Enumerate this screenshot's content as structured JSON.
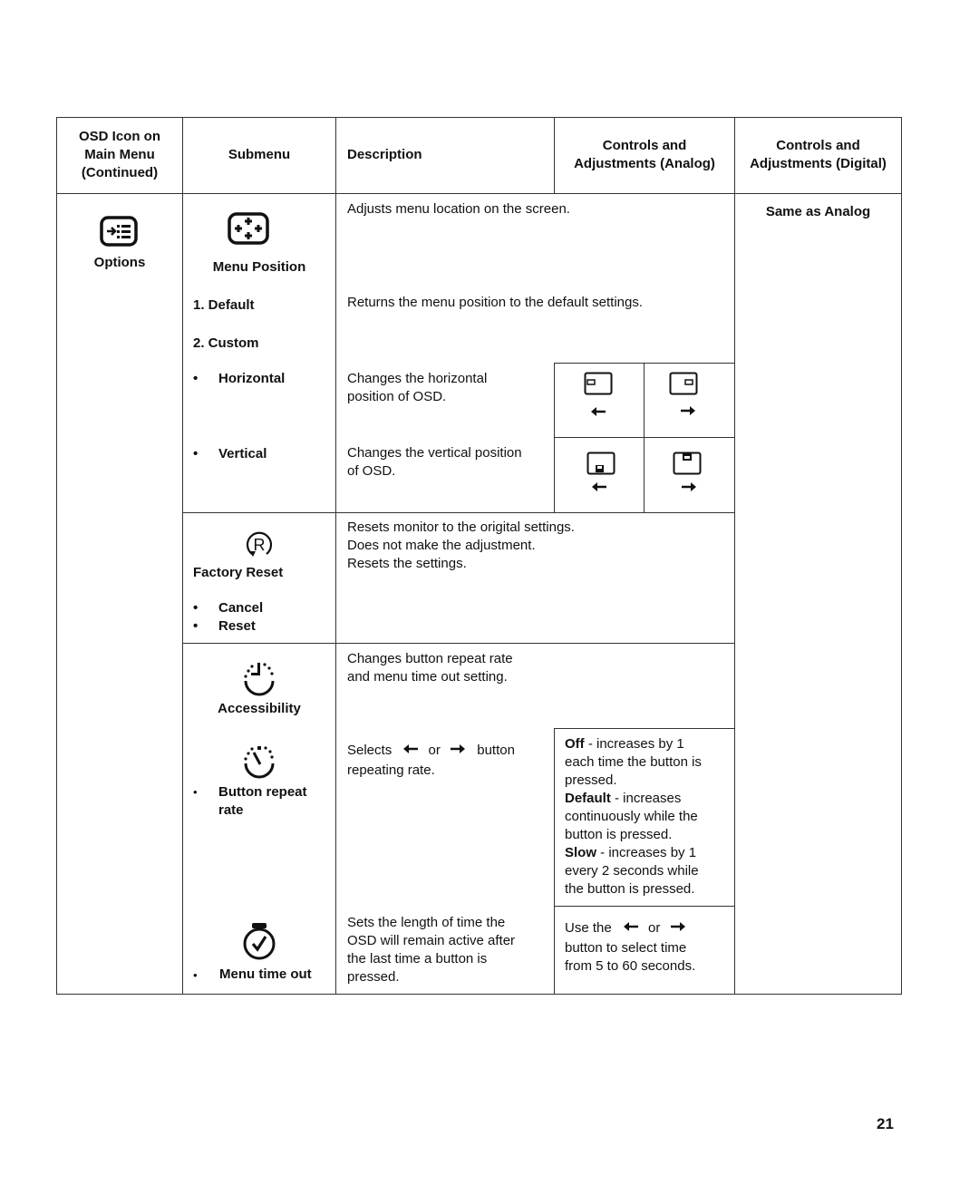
{
  "header": {
    "col1": [
      "OSD Icon on",
      "Main Menu",
      "(Continued)"
    ],
    "col2": "Submenu",
    "col3": "Description",
    "col4": [
      "Controls and",
      "Adjustments (Analog)"
    ],
    "col5": [
      "Controls and",
      "Adjustments (Digital)"
    ]
  },
  "main_menu": {
    "label": "Options",
    "icon": "options-icon"
  },
  "digital_note": "Same as Analog",
  "menu_position": {
    "label": "Menu Position",
    "icon": "menu-position-icon",
    "description": "Adjusts menu location on the screen.",
    "default_label": "1. Default",
    "default_desc": "Returns the menu position to the default settings.",
    "custom_label": "2. Custom",
    "horizontal_label": "Horizontal",
    "horizontal_desc": [
      "Changes the horizontal",
      "position of OSD."
    ],
    "vertical_label": "Vertical",
    "vertical_desc": [
      "Changes the vertical position",
      "of OSD."
    ],
    "bullet": "•"
  },
  "factory_reset": {
    "label": "Factory Reset",
    "icon": "factory-reset-icon",
    "options": [
      "Cancel",
      "Reset"
    ],
    "desc": [
      "Resets monitor to the origital settings.",
      "Does not make the adjustment.",
      "Resets the settings."
    ]
  },
  "accessibility": {
    "label": "Accessibility",
    "icon": "accessibility-icon",
    "desc": [
      "Changes button repeat rate",
      "and menu time out setting."
    ],
    "button_repeat": {
      "label": [
        "Button repeat",
        "rate"
      ],
      "icon": "button-repeat-icon",
      "desc_parts": [
        "Selects",
        "or",
        "button"
      ],
      "desc_line2": "repeating rate.",
      "options": [
        {
          "name": "Off",
          "text": [
            " - increases by 1",
            "each time the button is",
            "pressed."
          ]
        },
        {
          "name": "Default",
          "text": [
            " - increases",
            "continuously while the",
            "button is pressed."
          ]
        },
        {
          "name": "Slow",
          "text": [
            " - increases by 1",
            "every 2 seconds while",
            "the button is pressed."
          ]
        }
      ]
    },
    "menu_timeout": {
      "label": "Menu time out",
      "icon": "menu-timeout-icon",
      "desc": [
        "Sets the length of time the",
        "OSD will remain active after",
        "the last time a button is",
        "pressed."
      ],
      "analog_parts": [
        "Use the",
        "or"
      ],
      "analog_lines": [
        "button to select time",
        "from 5 to 60 seconds."
      ]
    }
  },
  "page_number": "21"
}
